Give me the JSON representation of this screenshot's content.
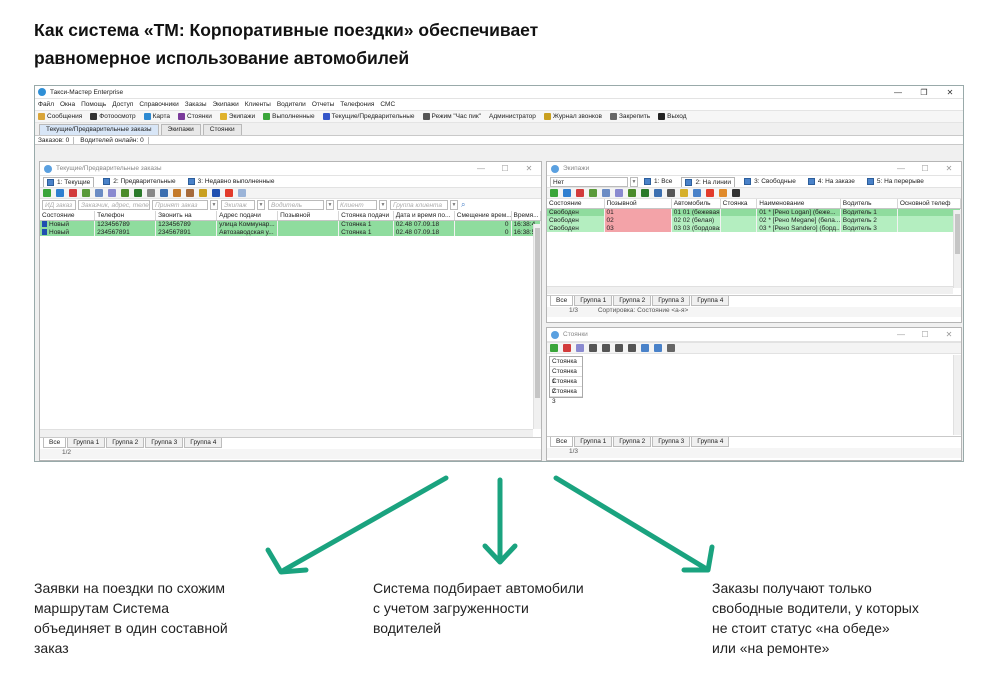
{
  "heading": {
    "line1": "Как система «ТМ: Корпоративные поездки» обеспечивает",
    "line2": "равномерное использование автомобилей"
  },
  "app": {
    "title": "Такси-Мастер Enterprise",
    "menu": [
      "Файл",
      "Окна",
      "Помощь",
      "Доступ",
      "Справочники",
      "Заказы",
      "Экипажи",
      "Клиенты",
      "Водители",
      "Отчеты",
      "Телефония",
      "СМС"
    ],
    "toolbar": [
      {
        "label": "Сообщения",
        "icon": "envelope-icon",
        "color": "#d9a53a"
      },
      {
        "label": "Фотоосмотр",
        "icon": "camera-icon",
        "color": "#333333"
      },
      {
        "label": "Карта",
        "icon": "globe-icon",
        "color": "#2d8ad2"
      },
      {
        "label": "Стоянки",
        "icon": "chart-icon",
        "color": "#7b3b9b"
      },
      {
        "label": "Экипажи",
        "icon": "car-icon",
        "color": "#e0b22c"
      },
      {
        "label": "Выполненные",
        "icon": "check-icon",
        "color": "#3aa53a"
      },
      {
        "label": "Текущие/Предварительные",
        "icon": "list-icon",
        "color": "#3456c9"
      },
      {
        "label": "Режим \"Час пик\"",
        "icon": "person-icon",
        "color": "#555555"
      },
      {
        "label": "Администратор",
        "icon": "",
        "color": ""
      },
      {
        "label": "Журнал звонков",
        "icon": "phone-book-icon",
        "color": "#c9a020"
      },
      {
        "label": "Закрепить",
        "icon": "pin-icon",
        "color": "#666666"
      },
      {
        "label": "Выход",
        "icon": "close-icon",
        "color": "#222222"
      }
    ],
    "main_tabs": [
      "Текущие/Предварительные заказы",
      "Экипажи",
      "Стоянки"
    ],
    "status": {
      "orders": "Заказов: 0",
      "drivers": "Водителей онлайн: 0"
    }
  },
  "orders_panel": {
    "title": "Текущие/Предварительные заказы",
    "tabs": [
      "1: Текущие",
      "2: Предварительные",
      "3: Недавно выполненные"
    ],
    "filters": [
      "ИД заказ",
      "Заказчик, адрес, телеф",
      "Принят заказ",
      "Экипаж",
      "Водитель",
      "Клиент",
      "Группа клиента"
    ],
    "columns": [
      "Состояние",
      "Телефон",
      "Звонить на",
      "Адрес подачи",
      "Позывной",
      "Стоянка подачи",
      "Дата и время по...",
      "Смещение врем...",
      "Время..."
    ],
    "rows": [
      [
        "Новый",
        "123456789",
        "123456789",
        "улица Коммунар...",
        "",
        "Стоянка 1",
        "02.48 07.09.18",
        "0",
        "16:38:4"
      ],
      [
        "Новый",
        "234567891",
        "234567891",
        "Автозаводская у...",
        "",
        "Стоянка 1",
        "02.48 07.09.18",
        "0",
        "16:38:5"
      ]
    ],
    "bottom_tabs": [
      "Все",
      "Группа 1",
      "Группа 2",
      "Группа 3",
      "Группа 4"
    ],
    "pager": "1/2"
  },
  "crews_panel": {
    "title": "Экипажи",
    "filter_value": "Нет",
    "tabs": [
      "1: Все",
      "2: На линии",
      "3: Свободные",
      "4: На заказе",
      "5: На перерыве"
    ],
    "columns": [
      "Состояние",
      "Позывной",
      "Автомобиль",
      "Стоянка",
      "Наименование",
      "Водитель",
      "Основной телеф"
    ],
    "rows": [
      [
        "Свободен",
        "01",
        "01 01 (бежевая)",
        "",
        "01 * [Рено Logan] (беже...",
        "Водитель 1",
        ""
      ],
      [
        "Свободен",
        "02",
        "02 02 (белая)",
        "",
        "02 * [Рено Megane] (бела...",
        "Водитель 2",
        ""
      ],
      [
        "Свободен",
        "03",
        "03 03 (бордовая)",
        "",
        "03 * [Рено Sandero] (борд...",
        "Водитель 3",
        ""
      ]
    ],
    "bottom_tabs": [
      "Все",
      "Группа 1",
      "Группа 2",
      "Группа 3",
      "Группа 4"
    ],
    "pager": "1/3",
    "sort_label": "Сортировка: Состояние <а-я>"
  },
  "stops_panel": {
    "title": "Стоянки",
    "list": [
      "Стоянка",
      "Стоянка 1",
      "Стоянка 2",
      "Стоянка 3"
    ],
    "bottom_tabs": [
      "Все",
      "Группа 1",
      "Группа 2",
      "Группа 3",
      "Группа 4"
    ],
    "pager": "1/3"
  },
  "captions": {
    "left": [
      "Заявки на поездки по схожим",
      "маршрутам Система",
      "объединяет в один составной",
      "заказ"
    ],
    "middle": [
      "Система подбирает автомобили",
      "с учетом загруженности",
      "водителей"
    ],
    "right": [
      "Заказы получают только",
      "свободные водители, у которых",
      "не стоит статус «на обеде»",
      "или «на ремонте»"
    ]
  },
  "colors": {
    "arrow": "#1aa37f",
    "row_green": "#8fdc9e",
    "cell_red": "#f3a3a8"
  }
}
